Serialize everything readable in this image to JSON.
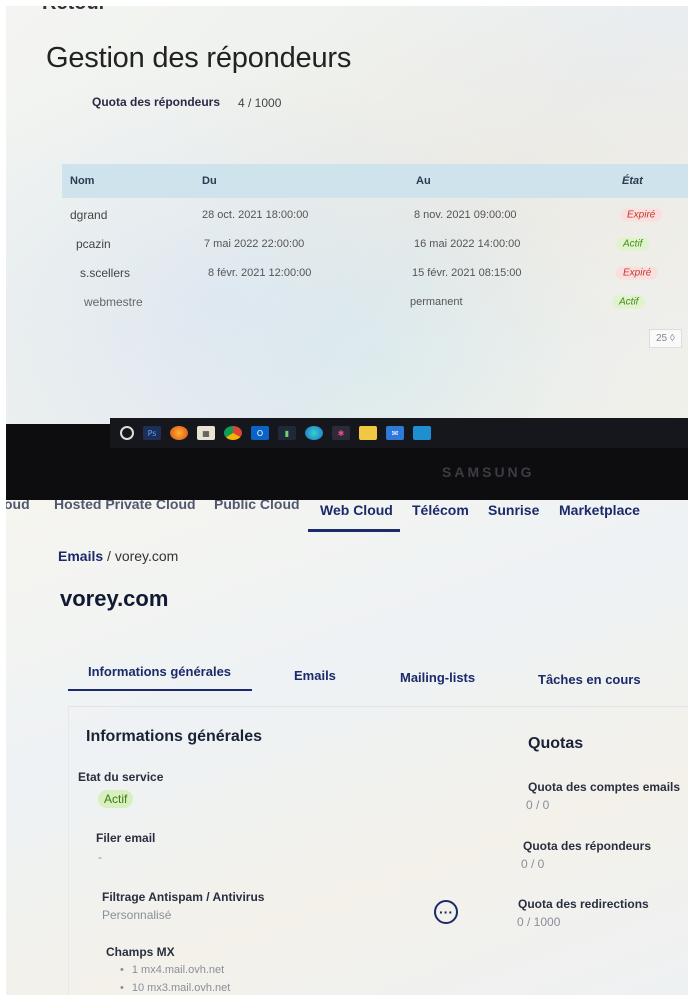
{
  "monitor_screen": {
    "cut_title": "Retour",
    "page_title": "Gestion des répondeurs",
    "quota_label": "Quota des répondeurs",
    "quota_value": "4 / 1000",
    "table": {
      "headers": [
        "Nom",
        "Du",
        "Au",
        "État"
      ],
      "rows": [
        {
          "nom": "dgrand",
          "du": "28 oct. 2021 18:00:00",
          "au": "8 nov. 2021 09:00:00",
          "etat": "Expiré"
        },
        {
          "nom": "pcazin",
          "du": "7 mai 2022 22:00:00",
          "au": "16 mai 2022 14:00:00",
          "etat": "Actif"
        },
        {
          "nom": "s.scellers",
          "du": "8 févr. 2021 12:00:00",
          "au": "15 févr. 2021 08:15:00",
          "etat": "Expiré"
        },
        {
          "nom": "webmestre",
          "du": "",
          "au": "permanent",
          "etat": "Actif"
        }
      ]
    },
    "pager": "25 ◊",
    "taskbar_icons": [
      "search-circle",
      "photoshop",
      "firefox",
      "calendar",
      "chrome",
      "outlook",
      "task-manager",
      "edge",
      "slack",
      "file-explorer",
      "mail",
      "app-icon"
    ],
    "monitor_brand": "SAMSUNG"
  },
  "manager": {
    "nav": [
      {
        "label": "oud",
        "state": "cut"
      },
      {
        "label": "Hosted Private Cloud",
        "state": "cut"
      },
      {
        "label": "Public Cloud",
        "state": "cut"
      },
      {
        "label": "Web Cloud",
        "state": "active"
      },
      {
        "label": "Télécom",
        "state": "normal"
      },
      {
        "label": "Sunrise",
        "state": "normal"
      },
      {
        "label": "Marketplace",
        "state": "normal"
      }
    ],
    "breadcrumb": {
      "link": "Emails",
      "separator": "/",
      "current": "vorey.com"
    },
    "domain_title": "vorey.com",
    "tabs": [
      "Informations générales",
      "Emails",
      "Mailing-lists",
      "Tâches en cours"
    ],
    "general": {
      "title": "Informations générales",
      "etat_label": "Etat du service",
      "etat_value": "Actif",
      "filer_label": "Filer email",
      "filer_value": "-",
      "antispam_label": "Filtrage Antispam / Antivirus",
      "antispam_value": "Personnalisé",
      "mx_label": "Champs MX",
      "mx_items": [
        "1 mx4.mail.ovh.net",
        "10 mx3.mail.ovh.net"
      ],
      "more_label": "···"
    },
    "quotas": {
      "title": "Quotas",
      "items": [
        {
          "label": "Quota des comptes emails",
          "value": "0 / 0"
        },
        {
          "label": "Quota des répondeurs",
          "value": "0 / 0"
        },
        {
          "label": "Quota des redirections",
          "value": "0 / 1000"
        }
      ]
    }
  }
}
